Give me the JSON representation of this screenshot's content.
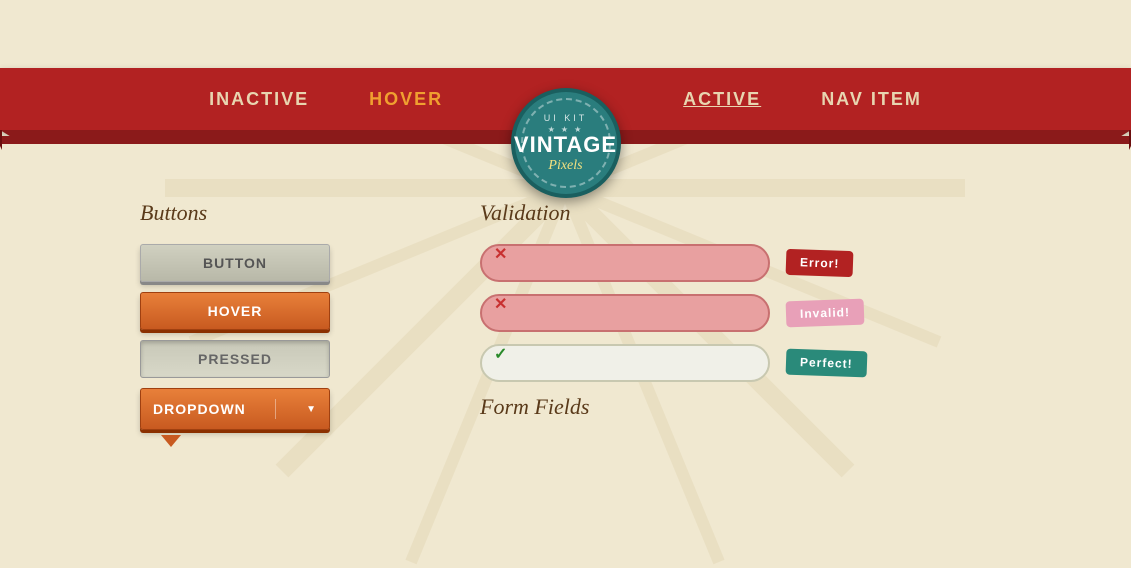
{
  "page": {
    "background_color": "#f0e8d0",
    "title": "Vintage Pixels UI Kit"
  },
  "logo": {
    "ui_kit_label": "UI Kit",
    "stars": "★ ★ ★",
    "vintage": "VINTAGE",
    "pixels": "Pixels"
  },
  "nav": {
    "items": [
      {
        "label": "INACTIVE",
        "state": "inactive"
      },
      {
        "label": "HOVER",
        "state": "hover"
      },
      {
        "label": "ACTIVE",
        "state": "active"
      },
      {
        "label": "NAV ITEM",
        "state": "nav-label"
      }
    ]
  },
  "buttons_section": {
    "title": "Buttons",
    "buttons": [
      {
        "label": "Button",
        "state": "default"
      },
      {
        "label": "Hover",
        "state": "hover"
      },
      {
        "label": "Pressed",
        "state": "pressed"
      },
      {
        "label": "Dropdown",
        "state": "dropdown"
      }
    ],
    "dropdown_arrow": "▼"
  },
  "validation_section": {
    "title": "Validation",
    "fields": [
      {
        "icon": "✕",
        "type": "error",
        "badge": "Error!",
        "badge_type": "error"
      },
      {
        "icon": "✕",
        "type": "error",
        "badge": "Invalid!",
        "badge_type": "invalid"
      },
      {
        "icon": "✓",
        "type": "success",
        "badge": "Perfect!",
        "badge_type": "perfect"
      }
    ]
  },
  "form_fields_section": {
    "title": "Form Fields"
  }
}
